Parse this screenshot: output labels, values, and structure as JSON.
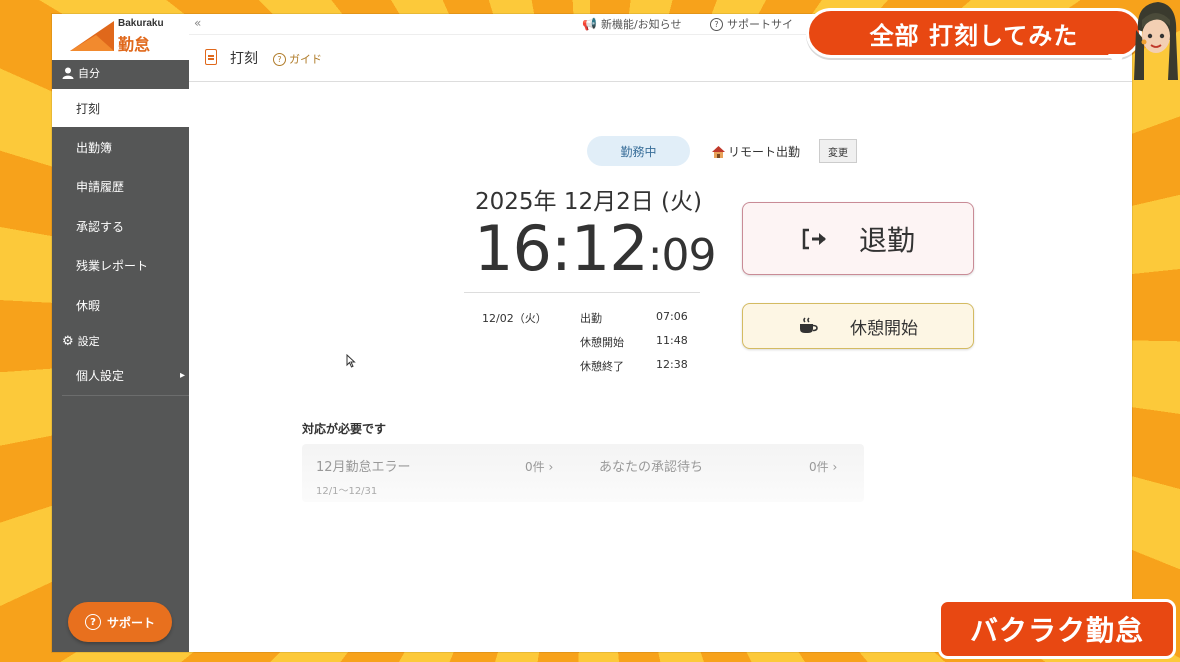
{
  "app": {
    "logo_en": "Bakuraku",
    "logo_jp": "勤怠",
    "brand_color": "#e0681b"
  },
  "sidebar": {
    "section_self": "自分",
    "items": [
      {
        "label": "打刻",
        "active": true
      },
      {
        "label": "出勤簿"
      },
      {
        "label": "申請履歴"
      },
      {
        "label": "承認する"
      },
      {
        "label": "残業レポート"
      },
      {
        "label": "休暇"
      }
    ],
    "section_settings": "設定",
    "personal_settings": "個人設定",
    "support": "サポート"
  },
  "topbar": {
    "news": "新機能/お知らせ",
    "support_site": "サポートサイ"
  },
  "header": {
    "title": "打刻",
    "guide": "ガイド"
  },
  "status": {
    "label": "勤務中",
    "remote": "リモート出勤",
    "change": "変更"
  },
  "clock": {
    "date": "2025年 12月2日 (火)",
    "hm": "16:12",
    "sec": ":09"
  },
  "log": {
    "date": "12/02（火）",
    "rows": [
      {
        "label": "出勤",
        "time": "07:06"
      },
      {
        "label": "休憩開始",
        "time": "11:48"
      },
      {
        "label": "休憩終了",
        "time": "12:38"
      }
    ]
  },
  "actions": {
    "clock_out": "退勤",
    "break_start": "休憩開始"
  },
  "todo": {
    "title": "対応が必要です",
    "cards": [
      {
        "label": "12月勤怠エラー",
        "count": "0件 ›",
        "sub": "12/1〜12/31"
      },
      {
        "label": "あなたの承認待ち",
        "count": "0件 ›"
      }
    ]
  },
  "overlay": {
    "top": "全部 打刻してみた",
    "bottom": "バクラク勤怠"
  }
}
